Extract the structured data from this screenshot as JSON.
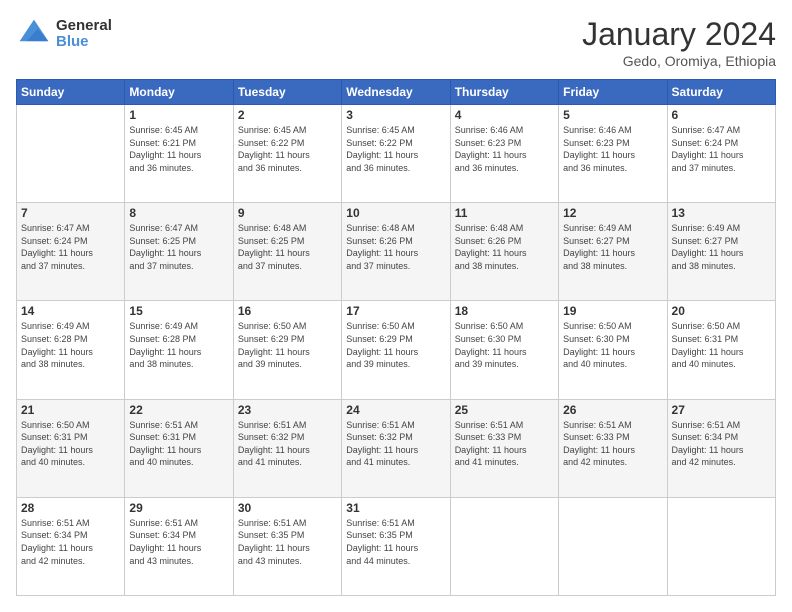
{
  "logo": {
    "general": "General",
    "blue": "Blue"
  },
  "header": {
    "month": "January 2024",
    "location": "Gedo, Oromiya, Ethiopia"
  },
  "weekdays": [
    "Sunday",
    "Monday",
    "Tuesday",
    "Wednesday",
    "Thursday",
    "Friday",
    "Saturday"
  ],
  "weeks": [
    [
      {
        "day": "",
        "info": ""
      },
      {
        "day": "1",
        "info": "Sunrise: 6:45 AM\nSunset: 6:21 PM\nDaylight: 11 hours\nand 36 minutes."
      },
      {
        "day": "2",
        "info": "Sunrise: 6:45 AM\nSunset: 6:22 PM\nDaylight: 11 hours\nand 36 minutes."
      },
      {
        "day": "3",
        "info": "Sunrise: 6:45 AM\nSunset: 6:22 PM\nDaylight: 11 hours\nand 36 minutes."
      },
      {
        "day": "4",
        "info": "Sunrise: 6:46 AM\nSunset: 6:23 PM\nDaylight: 11 hours\nand 36 minutes."
      },
      {
        "day": "5",
        "info": "Sunrise: 6:46 AM\nSunset: 6:23 PM\nDaylight: 11 hours\nand 36 minutes."
      },
      {
        "day": "6",
        "info": "Sunrise: 6:47 AM\nSunset: 6:24 PM\nDaylight: 11 hours\nand 37 minutes."
      }
    ],
    [
      {
        "day": "7",
        "info": "Sunrise: 6:47 AM\nSunset: 6:24 PM\nDaylight: 11 hours\nand 37 minutes."
      },
      {
        "day": "8",
        "info": "Sunrise: 6:47 AM\nSunset: 6:25 PM\nDaylight: 11 hours\nand 37 minutes."
      },
      {
        "day": "9",
        "info": "Sunrise: 6:48 AM\nSunset: 6:25 PM\nDaylight: 11 hours\nand 37 minutes."
      },
      {
        "day": "10",
        "info": "Sunrise: 6:48 AM\nSunset: 6:26 PM\nDaylight: 11 hours\nand 37 minutes."
      },
      {
        "day": "11",
        "info": "Sunrise: 6:48 AM\nSunset: 6:26 PM\nDaylight: 11 hours\nand 38 minutes."
      },
      {
        "day": "12",
        "info": "Sunrise: 6:49 AM\nSunset: 6:27 PM\nDaylight: 11 hours\nand 38 minutes."
      },
      {
        "day": "13",
        "info": "Sunrise: 6:49 AM\nSunset: 6:27 PM\nDaylight: 11 hours\nand 38 minutes."
      }
    ],
    [
      {
        "day": "14",
        "info": "Sunrise: 6:49 AM\nSunset: 6:28 PM\nDaylight: 11 hours\nand 38 minutes."
      },
      {
        "day": "15",
        "info": "Sunrise: 6:49 AM\nSunset: 6:28 PM\nDaylight: 11 hours\nand 38 minutes."
      },
      {
        "day": "16",
        "info": "Sunrise: 6:50 AM\nSunset: 6:29 PM\nDaylight: 11 hours\nand 39 minutes."
      },
      {
        "day": "17",
        "info": "Sunrise: 6:50 AM\nSunset: 6:29 PM\nDaylight: 11 hours\nand 39 minutes."
      },
      {
        "day": "18",
        "info": "Sunrise: 6:50 AM\nSunset: 6:30 PM\nDaylight: 11 hours\nand 39 minutes."
      },
      {
        "day": "19",
        "info": "Sunrise: 6:50 AM\nSunset: 6:30 PM\nDaylight: 11 hours\nand 40 minutes."
      },
      {
        "day": "20",
        "info": "Sunrise: 6:50 AM\nSunset: 6:31 PM\nDaylight: 11 hours\nand 40 minutes."
      }
    ],
    [
      {
        "day": "21",
        "info": "Sunrise: 6:50 AM\nSunset: 6:31 PM\nDaylight: 11 hours\nand 40 minutes."
      },
      {
        "day": "22",
        "info": "Sunrise: 6:51 AM\nSunset: 6:31 PM\nDaylight: 11 hours\nand 40 minutes."
      },
      {
        "day": "23",
        "info": "Sunrise: 6:51 AM\nSunset: 6:32 PM\nDaylight: 11 hours\nand 41 minutes."
      },
      {
        "day": "24",
        "info": "Sunrise: 6:51 AM\nSunset: 6:32 PM\nDaylight: 11 hours\nand 41 minutes."
      },
      {
        "day": "25",
        "info": "Sunrise: 6:51 AM\nSunset: 6:33 PM\nDaylight: 11 hours\nand 41 minutes."
      },
      {
        "day": "26",
        "info": "Sunrise: 6:51 AM\nSunset: 6:33 PM\nDaylight: 11 hours\nand 42 minutes."
      },
      {
        "day": "27",
        "info": "Sunrise: 6:51 AM\nSunset: 6:34 PM\nDaylight: 11 hours\nand 42 minutes."
      }
    ],
    [
      {
        "day": "28",
        "info": "Sunrise: 6:51 AM\nSunset: 6:34 PM\nDaylight: 11 hours\nand 42 minutes."
      },
      {
        "day": "29",
        "info": "Sunrise: 6:51 AM\nSunset: 6:34 PM\nDaylight: 11 hours\nand 43 minutes."
      },
      {
        "day": "30",
        "info": "Sunrise: 6:51 AM\nSunset: 6:35 PM\nDaylight: 11 hours\nand 43 minutes."
      },
      {
        "day": "31",
        "info": "Sunrise: 6:51 AM\nSunset: 6:35 PM\nDaylight: 11 hours\nand 44 minutes."
      },
      {
        "day": "",
        "info": ""
      },
      {
        "day": "",
        "info": ""
      },
      {
        "day": "",
        "info": ""
      }
    ]
  ]
}
